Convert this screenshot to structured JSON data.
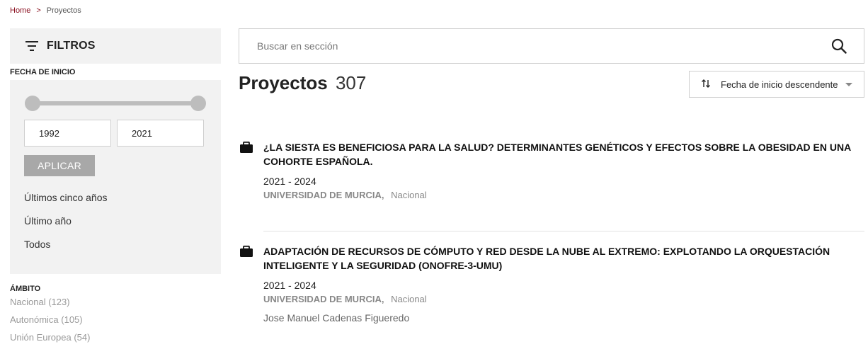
{
  "breadcrumb": {
    "home": "Home",
    "separator": ">",
    "current": "Proyectos"
  },
  "filters": {
    "title": "FILTROS",
    "date_section": {
      "label": "FECHA DE INICIO",
      "from": "1992",
      "to": "2021",
      "apply": "APLICAR",
      "quick": [
        "Últimos cinco años",
        "Último año",
        "Todos"
      ]
    },
    "ambito": {
      "label": "ÁMBITO",
      "items": [
        "Nacional (123)",
        "Autonómica (105)",
        "Unión Europea (54)"
      ]
    }
  },
  "search": {
    "placeholder": "Buscar en sección"
  },
  "page": {
    "title": "Proyectos",
    "count": "307"
  },
  "sort": {
    "label": "Fecha de inicio descendente"
  },
  "results": [
    {
      "title_line1": "¿LA SIESTA ES BENEFICIOSA PARA LA SALUD? DETERMINANTES GENÉTICOS Y EFECTOS SOBRE LA OBESIDAD EN UNA",
      "title_line2": "COHORTE ESPAÑOLA.",
      "years": "2021 - 2024",
      "org": "UNIVERSIDAD DE MURCIA,",
      "scope": "Nacional"
    },
    {
      "title_line1": "ADAPTACIÓN DE RECURSOS DE CÓMPUTO Y RED DESDE LA NUBE AL EXTREMO: EXPLOTANDO LA ORQUESTACIÓN",
      "title_line2": "INTELIGENTE Y LA SEGURIDAD (ONOFRE-3-UMU)",
      "years": "2021 - 2024",
      "org": "UNIVERSIDAD DE MURCIA,",
      "scope": "Nacional",
      "person": "Jose Manuel Cadenas Figueredo"
    }
  ],
  "colors": {
    "accent": "#8a1020",
    "panel": "#f2f2f2",
    "muted": "#888888"
  }
}
